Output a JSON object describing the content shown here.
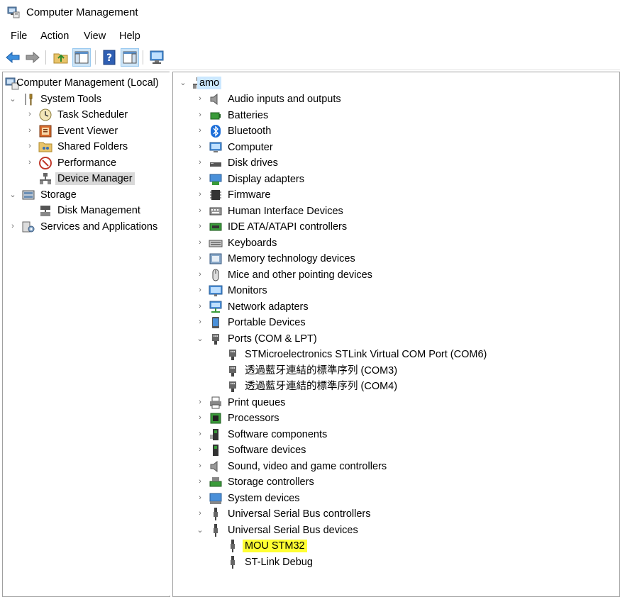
{
  "window": {
    "title": "Computer Management"
  },
  "menu": {
    "file": "File",
    "action": "Action",
    "view": "View",
    "help": "Help"
  },
  "left_tree": {
    "root": "Computer Management (Local)",
    "system_tools": "System Tools",
    "task_scheduler": "Task Scheduler",
    "event_viewer": "Event Viewer",
    "shared_folders": "Shared Folders",
    "performance": "Performance",
    "device_manager": "Device Manager",
    "storage": "Storage",
    "disk_management": "Disk Management",
    "services_apps": "Services and Applications"
  },
  "device_tree": {
    "root": "amo",
    "categories": [
      "Audio inputs and outputs",
      "Batteries",
      "Bluetooth",
      "Computer",
      "Disk drives",
      "Display adapters",
      "Firmware",
      "Human Interface Devices",
      "IDE ATA/ATAPI controllers",
      "Keyboards",
      "Memory technology devices",
      "Mice and other pointing devices",
      "Monitors",
      "Network adapters",
      "Portable Devices",
      "Ports (COM & LPT)",
      "Print queues",
      "Processors",
      "Software components",
      "Software devices",
      "Sound, video and game controllers",
      "Storage controllers",
      "System devices",
      "Universal Serial Bus controllers",
      "Universal Serial Bus devices"
    ],
    "ports_children": [
      "STMicroelectronics STLink Virtual COM Port (COM6)",
      "透過藍牙連結的標準序列 (COM3)",
      "透過藍牙連結的標準序列 (COM4)"
    ],
    "usb_devices_children": [
      "MOU STM32",
      "ST-Link Debug"
    ]
  },
  "highlight_color": "#ffff33",
  "selection_color": "#cce8ff"
}
